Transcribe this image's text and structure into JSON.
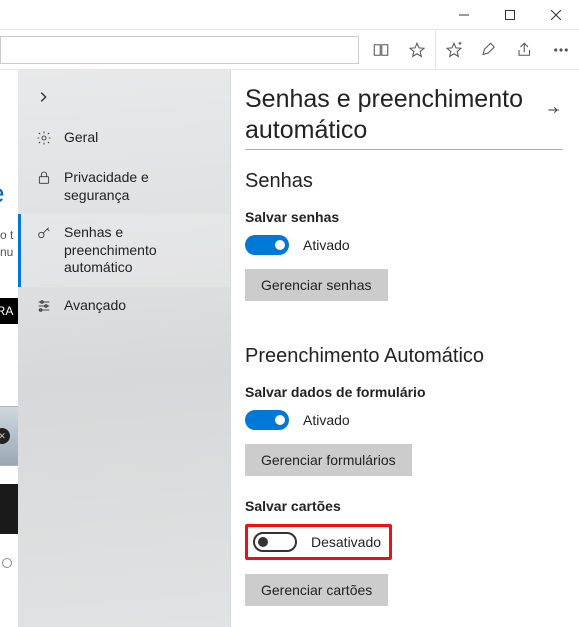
{
  "window_controls": {
    "min": "minimize",
    "max": "maximize",
    "close": "close"
  },
  "sidebar": {
    "items": [
      {
        "label": "Geral"
      },
      {
        "label": "Privacidade e segurança"
      },
      {
        "label": "Senhas e preenchimento automático"
      },
      {
        "label": "Avançado"
      }
    ]
  },
  "page": {
    "title": "Senhas e preenchimento automático",
    "sections": {
      "senhas": {
        "heading": "Senhas",
        "save_label": "Salvar senhas",
        "save_state": "Ativado",
        "manage_btn": "Gerenciar senhas"
      },
      "autofill": {
        "heading": "Preenchimento Automático",
        "form_label": "Salvar dados de formulário",
        "form_state": "Ativado",
        "manage_forms_btn": "Gerenciar formulários",
        "cards_label": "Salvar cartões",
        "cards_state": "Desativado",
        "manage_cards_btn": "Gerenciar cartões"
      }
    }
  },
  "bg": {
    "e": "e",
    "t1": "o t",
    "t2": "nu",
    "ra": "RA"
  }
}
